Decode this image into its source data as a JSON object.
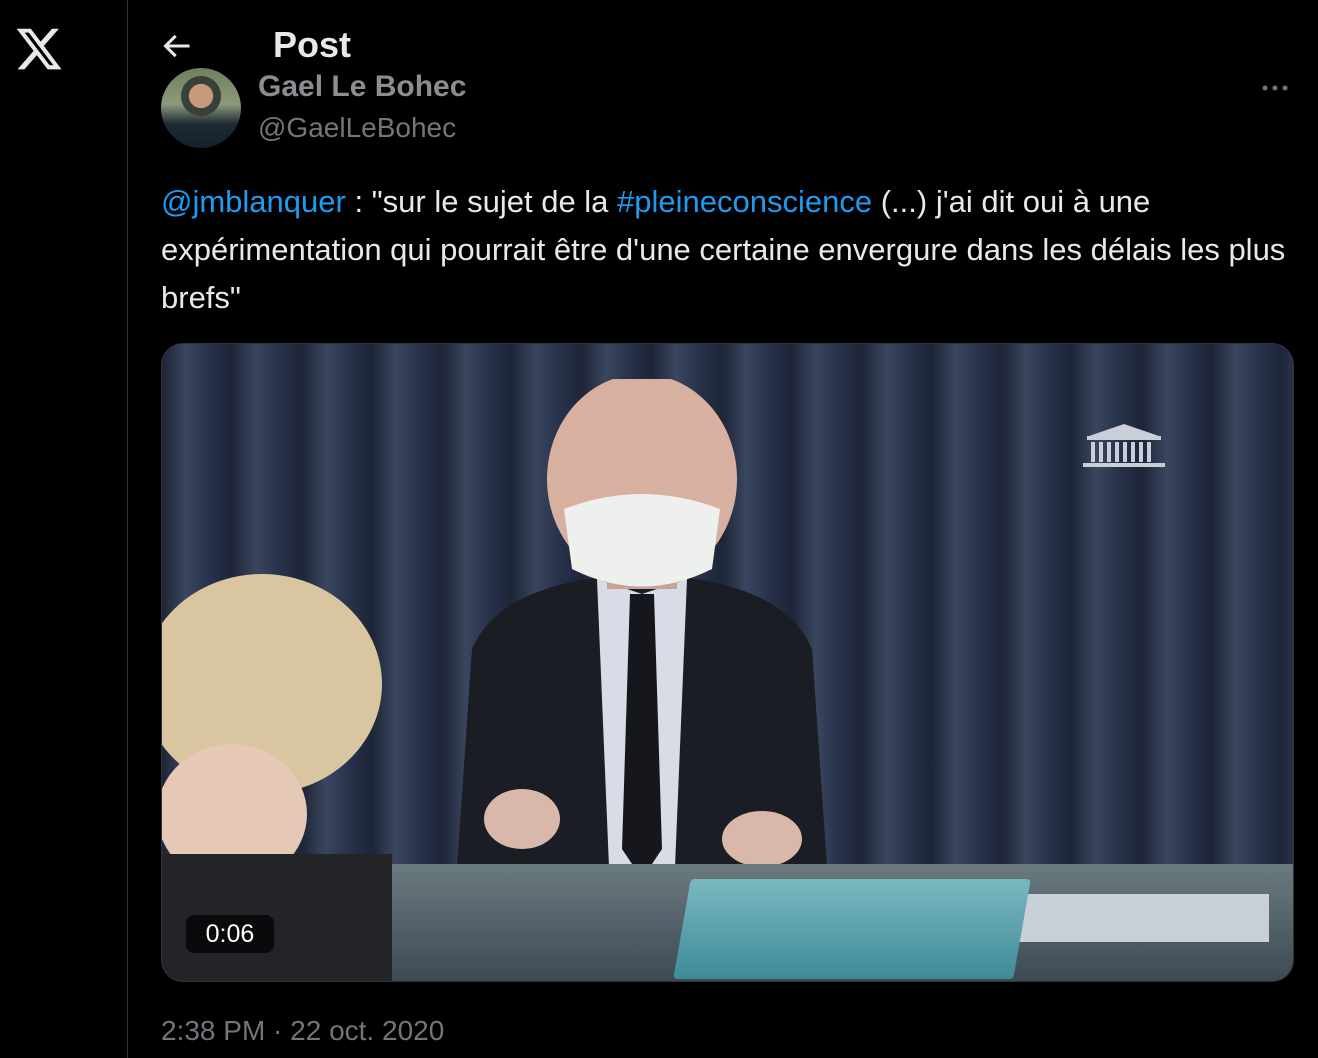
{
  "header": {
    "title": "Post"
  },
  "author": {
    "name": "Gael Le Bohec",
    "handle": "@GaelLeBohec"
  },
  "tweet": {
    "mention": "@jmblanquer",
    "text_part1": " : \"sur le sujet de la ",
    "hashtag": "#pleineconscience",
    "text_part2": " (...) j'ai dit oui à une expérimentation qui pourrait être d'une certaine envergure dans les délais les plus brefs\""
  },
  "media": {
    "duration": "0:06"
  },
  "meta": {
    "timestamp": "2:38 PM · 22 oct. 2020"
  },
  "colors": {
    "link": "#1d9bf0",
    "background": "#000000",
    "muted": "#71767b"
  },
  "icons": {
    "logo": "x-logo-icon",
    "back": "arrow-left-icon",
    "more": "more-horizontal-icon"
  }
}
